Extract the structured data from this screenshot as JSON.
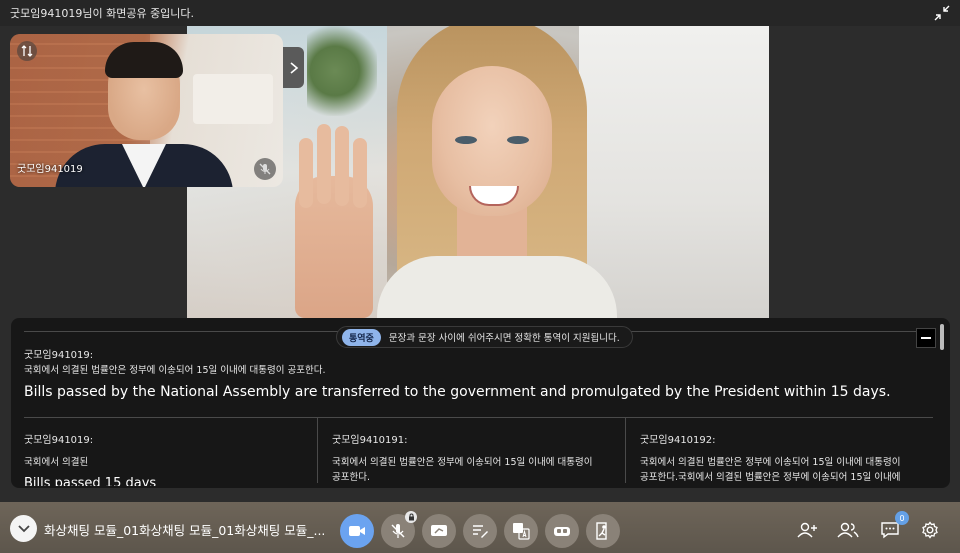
{
  "topbar": {
    "share_notice": "굿모임941019님이 화면공유 중입니다."
  },
  "pip": {
    "participant_name": "굿모임941019"
  },
  "interpretation": {
    "badge": "통역중",
    "notice": "문장과 문장 사이에 쉬어주시면 정확한 통역이 지원됩니다.",
    "main": {
      "speaker": "굿모임941019:",
      "korean": "국회에서 의결된 법률안은 정부에 이송되어 15일 이내에 대통령이 공포한다.",
      "english": "Bills passed by the National Assembly are transferred to the government and promulgated by the President within 15 days."
    },
    "columns": [
      {
        "speaker": "굿모임941019:",
        "korean": "국회에서 의결된",
        "english": "Bills passed 15 days"
      },
      {
        "speaker": "굿모임9410191:",
        "korean": "국회에서 의결된 법률안은 정부에 이송되어 15일 이내에 대통령이 공포한다."
      },
      {
        "speaker": "굿모임9410192:",
        "korean": "국회에서 의결된 법률안은 정부에 이송되어 15일 이내에 대통령이 공포한다.국회에서 의결된 법률안은 정부에 이송되어 15일 이내에"
      }
    ]
  },
  "bottombar": {
    "meeting_title": "화상채팅 모듈_01화상채팅 모듈_01화상채팅 모듈_...",
    "chat_count": "0"
  },
  "colors": {
    "accent": "#6ba3f0",
    "badge": "#8fb4ea"
  }
}
